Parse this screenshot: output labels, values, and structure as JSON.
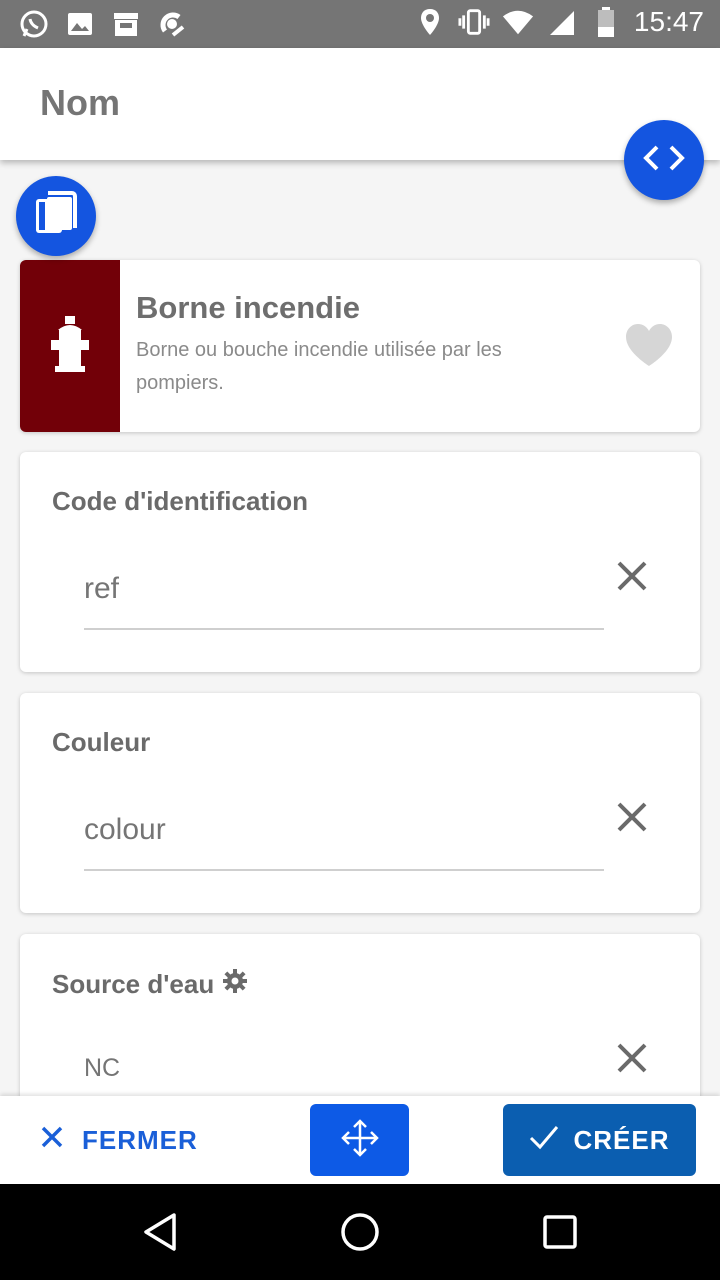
{
  "status_bar": {
    "time": "15:47",
    "left_icons": [
      "whatsapp-icon",
      "image-icon",
      "store-icon",
      "pokemon-icon"
    ],
    "right_icons": [
      "location-icon",
      "vibrate-icon",
      "wifi-icon",
      "signal-icon",
      "battery-icon"
    ]
  },
  "header": {
    "name_placeholder": "Nom"
  },
  "preset": {
    "title": "Borne incendie",
    "description": "Borne ou bouche incendie utilisée par les pompiers.",
    "swatch_color": "#720008",
    "icon": "fire-hydrant-icon",
    "favorite_icon": "heart-icon"
  },
  "fields": [
    {
      "label": "Code d'identification",
      "placeholder": "ref"
    },
    {
      "label": "Couleur",
      "placeholder": "colour"
    },
    {
      "label": "Source d'eau",
      "placeholder": "NC",
      "icon": "gear-icon"
    }
  ],
  "actions": {
    "close_label": "FERMER",
    "create_label": "CRÉER",
    "move_icon": "move-arrows-icon"
  },
  "colors": {
    "accent": "#1455e0",
    "create_button": "#0b5eb0",
    "status_bar": "#757575"
  }
}
